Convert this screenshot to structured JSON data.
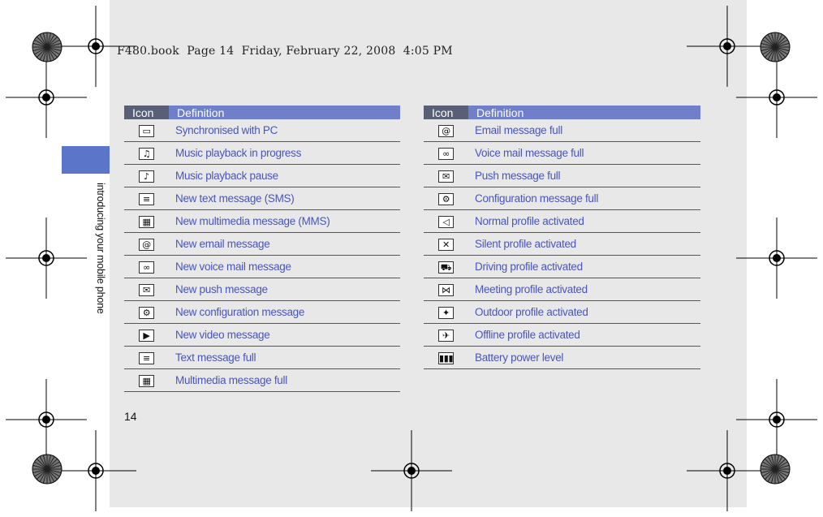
{
  "header": {
    "text": "F480.book  Page 14  Friday, February 22, 2008  4:05 PM"
  },
  "side_tab": {
    "text": "introducing your mobile phone"
  },
  "page_number": "14",
  "left_table": {
    "headers": [
      "Icon",
      "Definition"
    ],
    "rows": [
      {
        "icon": "pc-sync-icon",
        "glyph": "▭",
        "definition": "Synchronised with PC"
      },
      {
        "icon": "music-play-icon",
        "glyph": "♫",
        "definition": "Music playback in progress"
      },
      {
        "icon": "music-pause-icon",
        "glyph": "♪",
        "definition": "Music playback pause"
      },
      {
        "icon": "sms-icon",
        "glyph": "≡",
        "definition": "New text message (SMS)"
      },
      {
        "icon": "mms-icon",
        "glyph": "▦",
        "definition": "New multimedia message (MMS)"
      },
      {
        "icon": "email-icon",
        "glyph": "@",
        "definition": "New email message"
      },
      {
        "icon": "voicemail-icon",
        "glyph": "∞",
        "definition": "New voice mail message"
      },
      {
        "icon": "push-message-icon",
        "glyph": "✉",
        "definition": "New push message"
      },
      {
        "icon": "config-message-icon",
        "glyph": "⚙",
        "definition": "New configuration message"
      },
      {
        "icon": "video-message-icon",
        "glyph": "▶",
        "definition": "New video message"
      },
      {
        "icon": "text-full-icon",
        "glyph": "≡",
        "definition": "Text message full"
      },
      {
        "icon": "mms-full-icon",
        "glyph": "▦",
        "definition": "Multimedia message full"
      }
    ]
  },
  "right_table": {
    "headers": [
      "Icon",
      "Definition"
    ],
    "rows": [
      {
        "icon": "email-full-icon",
        "glyph": "@",
        "definition": "Email message full"
      },
      {
        "icon": "voicemail-full-icon",
        "glyph": "∞",
        "definition": "Voice mail message full"
      },
      {
        "icon": "push-full-icon",
        "glyph": "✉",
        "definition": "Push message full"
      },
      {
        "icon": "config-full-icon",
        "glyph": "⚙",
        "definition": "Configuration message full"
      },
      {
        "icon": "speaker-icon",
        "glyph": "◁",
        "definition": "Normal profile activated"
      },
      {
        "icon": "silent-icon",
        "glyph": "✕",
        "definition": "Silent profile activated"
      },
      {
        "icon": "car-icon",
        "glyph": "⛟",
        "definition": "Driving profile activated"
      },
      {
        "icon": "meeting-icon",
        "glyph": "⋈",
        "definition": "Meeting profile activated"
      },
      {
        "icon": "outdoor-icon",
        "glyph": "✦",
        "definition": "Outdoor profile activated"
      },
      {
        "icon": "offline-icon",
        "glyph": "✈",
        "definition": "Offline profile activated"
      },
      {
        "icon": "battery-icon",
        "glyph": "▮▮▮",
        "definition": "Battery power level"
      }
    ]
  }
}
